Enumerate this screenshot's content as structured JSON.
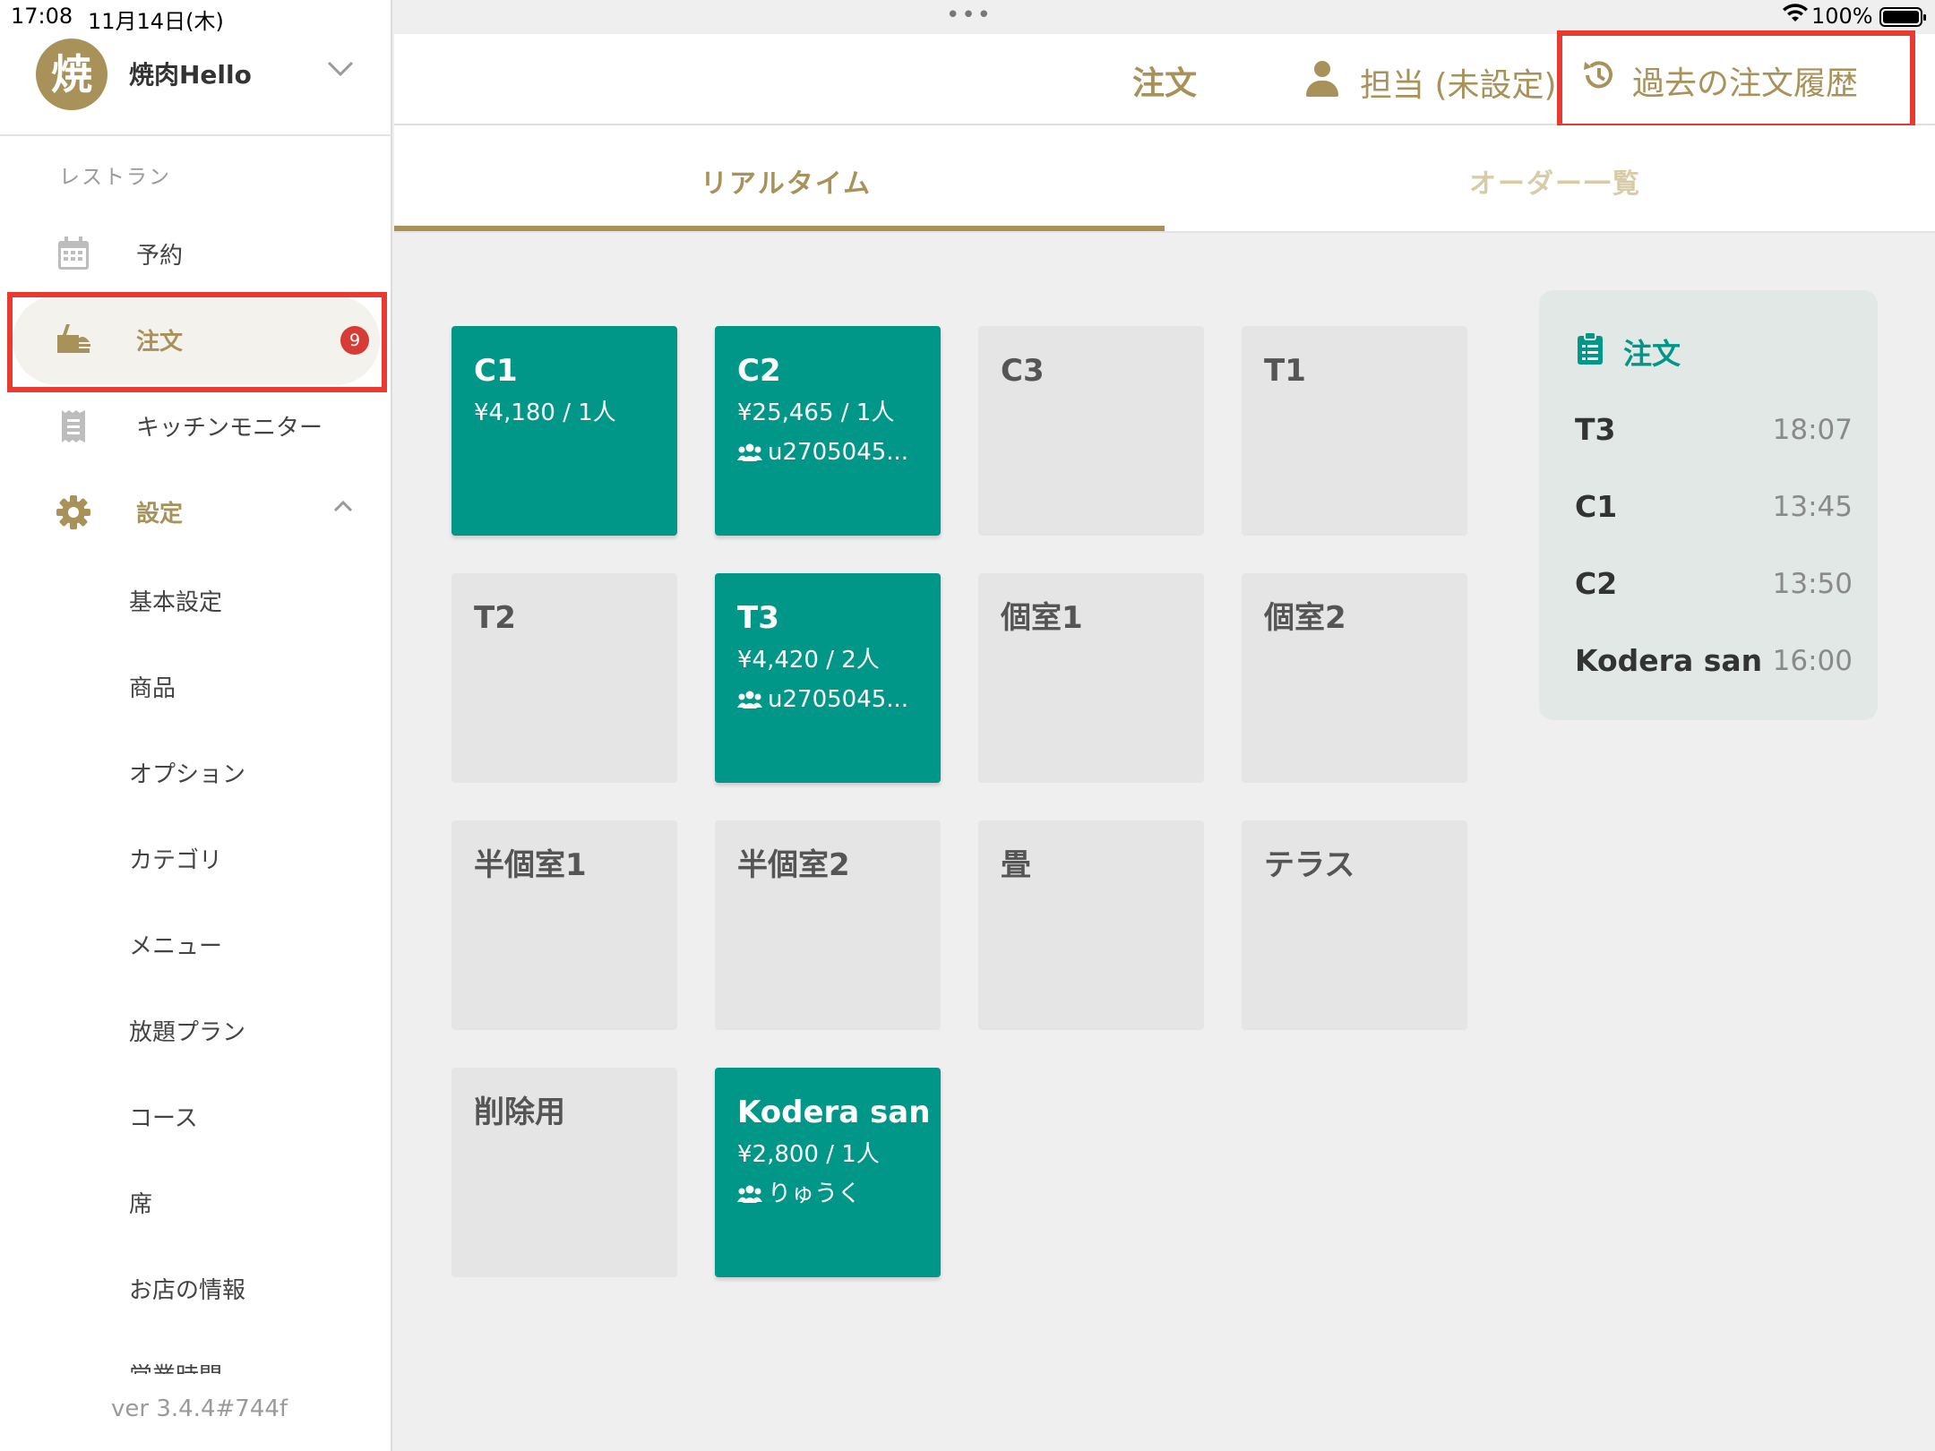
{
  "status_bar": {
    "time": "17:08",
    "date": "11月14日(木)",
    "dots": "•••",
    "battery_percent": "100%"
  },
  "shop": {
    "avatar_char": "焼",
    "name": "焼肉Hello"
  },
  "sidebar": {
    "section": "レストラン",
    "items": [
      {
        "label": "予約",
        "icon": "calendar-icon"
      },
      {
        "label": "注文",
        "icon": "order-icon",
        "badge": "9",
        "active": true
      },
      {
        "label": "キッチンモニター",
        "icon": "receipt-icon"
      },
      {
        "label": "設定",
        "icon": "gear-icon",
        "expanded": true
      }
    ],
    "settings_items": [
      "基本設定",
      "商品",
      "オプション",
      "カテゴリ",
      "メニュー",
      "放題プラン",
      "コース",
      "席",
      "お店の情報",
      "営業時間"
    ],
    "version": "ver 3.4.4#744f"
  },
  "header": {
    "title": "注文",
    "staff": "担当 (未設定)",
    "history": "過去の注文履歴"
  },
  "tabs": [
    {
      "label": "リアルタイム",
      "active": true
    },
    {
      "label": "オーダー一覧",
      "active": false
    }
  ],
  "tables": [
    {
      "name": "C1",
      "amount": "¥4,180 / 1人",
      "user": "",
      "occupied": true
    },
    {
      "name": "C2",
      "amount": "¥25,465 / 1人",
      "user": "u2705045...",
      "occupied": true
    },
    {
      "name": "C3",
      "amount": "",
      "user": "",
      "occupied": false
    },
    {
      "name": "T1",
      "amount": "",
      "user": "",
      "occupied": false
    },
    {
      "name": "T2",
      "amount": "",
      "user": "",
      "occupied": false
    },
    {
      "name": "T3",
      "amount": "¥4,420 / 2人",
      "user": "u2705045...",
      "occupied": true
    },
    {
      "name": "個室1",
      "amount": "",
      "user": "",
      "occupied": false
    },
    {
      "name": "個室2",
      "amount": "",
      "user": "",
      "occupied": false
    },
    {
      "name": "半個室1",
      "amount": "",
      "user": "",
      "occupied": false
    },
    {
      "name": "半個室2",
      "amount": "",
      "user": "",
      "occupied": false
    },
    {
      "name": "畳",
      "amount": "",
      "user": "",
      "occupied": false
    },
    {
      "name": "テラス",
      "amount": "",
      "user": "",
      "occupied": false
    },
    {
      "name": "削除用",
      "amount": "",
      "user": "",
      "occupied": false
    },
    {
      "name": "Kodera san",
      "amount": "¥2,800 / 1人",
      "user": "りゅうく",
      "occupied": true
    }
  ],
  "order_panel": {
    "title": "注文",
    "rows": [
      {
        "table": "T3",
        "time": "18:07"
      },
      {
        "table": "C1",
        "time": "13:45"
      },
      {
        "table": "C2",
        "time": "13:50"
      },
      {
        "table": "Kodera san",
        "time": "16:00"
      }
    ]
  },
  "colors": {
    "gold": "#a8925a",
    "teal": "#009688",
    "highlight_red": "#e83a31",
    "badge_red": "#d63b36"
  }
}
